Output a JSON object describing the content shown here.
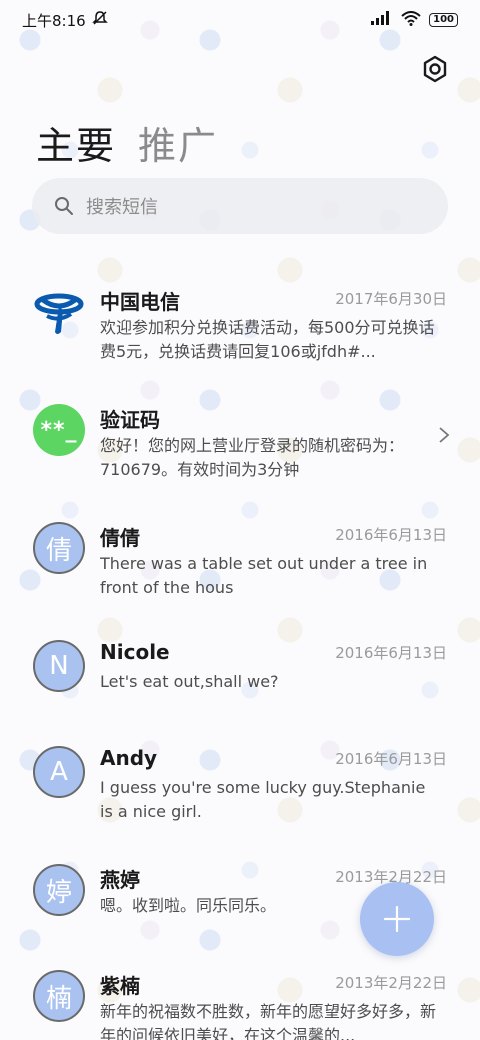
{
  "status_bar": {
    "time": "上午8:16",
    "battery": "100"
  },
  "tabs": [
    {
      "label": "主要",
      "active": true
    },
    {
      "label": "推广",
      "active": false
    }
  ],
  "search": {
    "placeholder": "搜索短信"
  },
  "conversations": [
    {
      "avatar_text": "",
      "avatar_type": "telecom-logo",
      "name": "中国电信",
      "date": "2017年6月30日",
      "preview": "欢迎参加积分兑换话费活动，每500分可兑换话费5元，兑换话费请回复106或jfdh#..."
    },
    {
      "avatar_text": "**_",
      "avatar_type": "green",
      "name": "验证码",
      "date": "",
      "preview": "您好！您的网上营业厅登录的随机密码为：710679。有效时间为3分钟"
    },
    {
      "avatar_text": "倩",
      "avatar_type": "letter",
      "name": "倩倩",
      "date": "2016年6月13日",
      "preview": "There was a table set out under a tree in front of the hous"
    },
    {
      "avatar_text": "N",
      "avatar_type": "letter",
      "name": "Nicole",
      "date": "2016年6月13日",
      "preview": "Let's eat out,shall we?"
    },
    {
      "avatar_text": "A",
      "avatar_type": "letter",
      "name": "Andy",
      "date": "2016年6月13日",
      "preview": "I guess you're some lucky guy.Stephanie is a nice girl."
    },
    {
      "avatar_text": "婷",
      "avatar_type": "letter",
      "name": "燕婷",
      "date": "2013年2月22日",
      "preview": "嗯。收到啦。同乐同乐。"
    },
    {
      "avatar_text": "楠",
      "avatar_type": "letter",
      "name": "紫楠",
      "date": "2013年2月22日",
      "preview": "新年的祝福数不胜数，新年的愿望好多好多，新年的问候依旧美好，在这个温馨的..."
    }
  ],
  "colors": {
    "avatar_blue": "#a9c2ef",
    "avatar_green": "#5cd562",
    "fab": "#a8c0f2",
    "telecom_blue": "#0a5ab0"
  }
}
